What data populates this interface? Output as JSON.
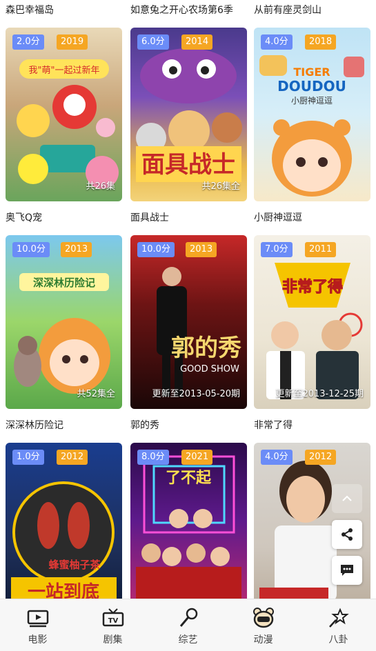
{
  "rows": [
    {
      "titles": [
        "森巴幸福岛",
        "如意兔之开心农场第6季",
        "从前有座灵剑山"
      ],
      "items": [
        {
          "score": "2.0分",
          "year": "2019",
          "caption": "共26集",
          "art": "art-a"
        },
        {
          "score": "6.0分",
          "year": "2014",
          "caption": "共26集全",
          "art": "art-b"
        },
        {
          "score": "4.0分",
          "year": "2018",
          "caption": "",
          "art": "art-c"
        }
      ]
    },
    {
      "titles": [
        "奥飞Q宠",
        "面具战士",
        "小厨神逗逗"
      ],
      "items": [
        {
          "score": "10.0分",
          "year": "2013",
          "caption": "共52集全",
          "art": "art-d"
        },
        {
          "score": "10.0分",
          "year": "2013",
          "caption": "更新至2013-05-20期",
          "art": "art-e"
        },
        {
          "score": "7.0分",
          "year": "2011",
          "caption": "更新至2013-12-25期",
          "art": "art-f"
        }
      ]
    },
    {
      "titles": [
        "深深林历险记",
        "郭的秀",
        "非常了得"
      ],
      "items": [
        {
          "score": "1.0分",
          "year": "2012",
          "caption": "",
          "art": "art-g"
        },
        {
          "score": "8.0分",
          "year": "2021",
          "caption": "",
          "art": "art-h"
        },
        {
          "score": "4.0分",
          "year": "2012",
          "caption": "",
          "art": "art-i"
        }
      ]
    }
  ],
  "poster_text": {
    "p1": "我\"萌\"一起过新年",
    "p2": "面具战士",
    "p3a": "TIGER",
    "p3b": "DOUDOU",
    "p3c": "小厨神逗逗",
    "p4": "深深林历险记",
    "p5": "郭的秀",
    "p5b": "GOOD SHOW",
    "p6": "非常了得",
    "p7": "一站到底",
    "p7b": "蜂蜜柚子茶",
    "p8": "了不起"
  },
  "tabs": [
    {
      "label": "电影",
      "icon": "film-icon"
    },
    {
      "label": "剧集",
      "icon": "tv-icon"
    },
    {
      "label": "综艺",
      "icon": "microphone-icon"
    },
    {
      "label": "动漫",
      "icon": "bear-icon"
    },
    {
      "label": "八卦",
      "icon": "star-wand-icon"
    }
  ],
  "floating": [
    "scroll-top-icon",
    "share-icon",
    "comment-icon"
  ]
}
